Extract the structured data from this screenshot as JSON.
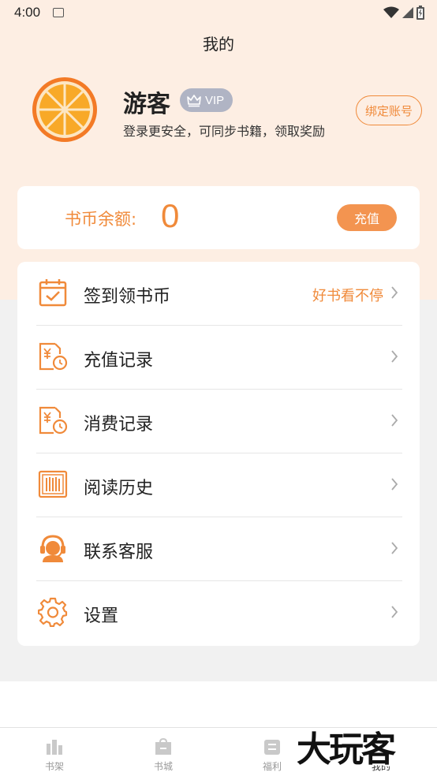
{
  "status_bar": {
    "time": "4:00"
  },
  "header": {
    "title": "我的"
  },
  "user": {
    "name": "游客",
    "vip_label": "VIP",
    "subtitle": "登录更安全，可同步书籍，领取奖励",
    "bind_button": "绑定账号"
  },
  "balance": {
    "label": "书币余额:",
    "value": "0",
    "recharge_button": "充值"
  },
  "menu": {
    "items": [
      {
        "label": "签到领书币",
        "extra": "好书看不停",
        "icon": "calendar-check-icon"
      },
      {
        "label": "充值记录",
        "extra": "",
        "icon": "recharge-record-icon"
      },
      {
        "label": "消费记录",
        "extra": "",
        "icon": "consumption-record-icon"
      },
      {
        "label": "阅读历史",
        "extra": "",
        "icon": "reading-history-icon"
      },
      {
        "label": "联系客服",
        "extra": "",
        "icon": "customer-service-icon"
      },
      {
        "label": "设置",
        "extra": "",
        "icon": "settings-gear-icon"
      }
    ]
  },
  "bottom_nav": {
    "items": [
      {
        "label": "书架",
        "icon": "bookshelf-icon"
      },
      {
        "label": "书城",
        "icon": "bookstore-icon"
      },
      {
        "label": "福利",
        "icon": "welfare-icon"
      },
      {
        "label": "我的",
        "icon": "profile-icon"
      }
    ],
    "active": "我的"
  },
  "watermark": {
    "text": "大玩客"
  },
  "colors": {
    "accent": "#f08a3a",
    "header_bg": "#fdeee3",
    "page_bg": "#f1f1f1",
    "vip_badge": "#b0b4c4"
  }
}
